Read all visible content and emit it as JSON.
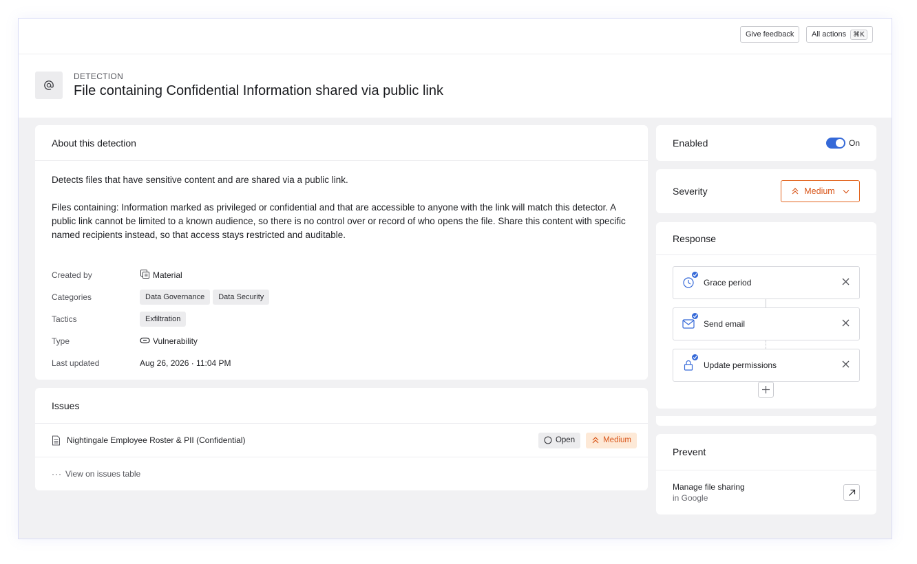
{
  "topbar": {
    "feedback_label": "Give feedback",
    "actions_label": "All actions",
    "actions_shortcut": "⌘K"
  },
  "header": {
    "eyebrow": "DETECTION",
    "title": "File containing Confidential Information shared via public link",
    "icon": "at-sign-icon"
  },
  "about": {
    "heading": "About this detection",
    "paragraph1": "Detects files that have sensitive content and are shared via a public link.",
    "paragraph2": "Files containing: Information marked as privileged or confidential and that are accessible to anyone with the link will match this detector. A public link cannot be limited to a known audience, so there is no control over or record of who opens the file. Share this content with specific named recipients instead, so that access stays restricted and auditable.",
    "meta": {
      "created_by_label": "Created by",
      "created_by_value": "Material",
      "categories_label": "Categories",
      "categories": [
        "Data Governance",
        "Data Security"
      ],
      "tactics_label": "Tactics",
      "tactics": [
        "Exfiltration"
      ],
      "type_label": "Type",
      "type_value": "Vulnerability",
      "last_updated_label": "Last updated",
      "last_updated_value": "Aug 26, 2026 · 11:04 PM"
    }
  },
  "issues": {
    "heading": "Issues",
    "items": [
      {
        "name": "Nightingale Employee Roster & PII (Confidential)",
        "status": "Open",
        "severity": "Medium"
      }
    ],
    "view_link": "View on issues table"
  },
  "enabled": {
    "label": "Enabled",
    "state_label": "On",
    "is_on": true
  },
  "severity": {
    "label": "Severity",
    "value": "Medium",
    "color": "#e2621b"
  },
  "response": {
    "heading": "Response",
    "steps": [
      {
        "label": "Grace period",
        "icon": "clock-icon"
      },
      {
        "label": "Send email",
        "icon": "mail-icon"
      },
      {
        "label": "Update permissions",
        "icon": "lock-icon"
      }
    ]
  },
  "prevent": {
    "heading": "Prevent",
    "action_title": "Manage file sharing",
    "action_subtitle": "in Google"
  },
  "colors": {
    "accent": "#3569d8",
    "medium": "#e2621b",
    "medium_bg": "#fde9d7"
  }
}
